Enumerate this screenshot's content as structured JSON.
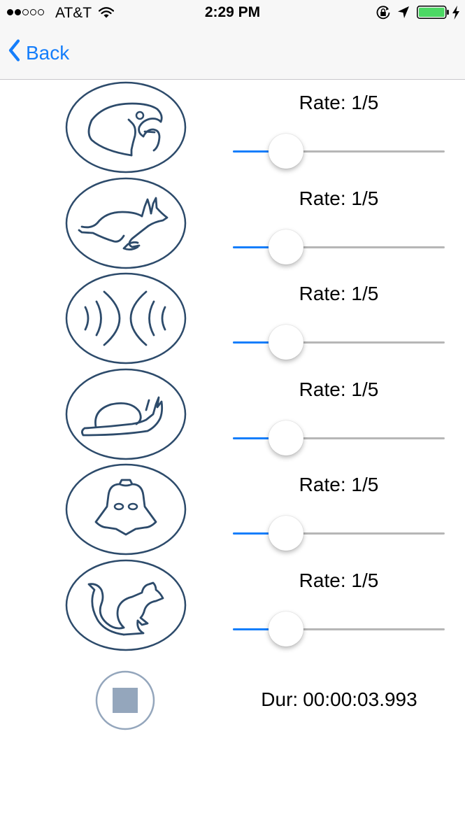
{
  "status_bar": {
    "carrier": "AT&T",
    "signal_bars_filled": 2,
    "signal_bars_total": 5,
    "time": "2:29 PM",
    "icons": [
      "wifi-icon",
      "rotation-lock-icon",
      "location-arrow-icon",
      "battery-icon",
      "charging-bolt-icon"
    ],
    "battery_color": "#4cd964"
  },
  "nav": {
    "back_label": "Back",
    "accent_color": "#157efb"
  },
  "effects": [
    {
      "icon": "parrot-icon",
      "rate_label": "Rate: 1/5",
      "slider_value": 0.25
    },
    {
      "icon": "rabbit-icon",
      "rate_label": "Rate: 1/5",
      "slider_value": 0.25
    },
    {
      "icon": "echo-waves-icon",
      "rate_label": "Rate: 1/5",
      "slider_value": 0.25
    },
    {
      "icon": "snail-icon",
      "rate_label": "Rate: 1/5",
      "slider_value": 0.25
    },
    {
      "icon": "darth-vader-icon",
      "rate_label": "Rate: 1/5",
      "slider_value": 0.25
    },
    {
      "icon": "squirrel-icon",
      "rate_label": "Rate: 1/5",
      "slider_value": 0.25
    }
  ],
  "effect_icon_color": "#2d4b6b",
  "stop": {
    "icon": "stop-icon",
    "color": "#94a6bc"
  },
  "duration": {
    "label": "Dur:",
    "value": "00:00:03.993"
  }
}
